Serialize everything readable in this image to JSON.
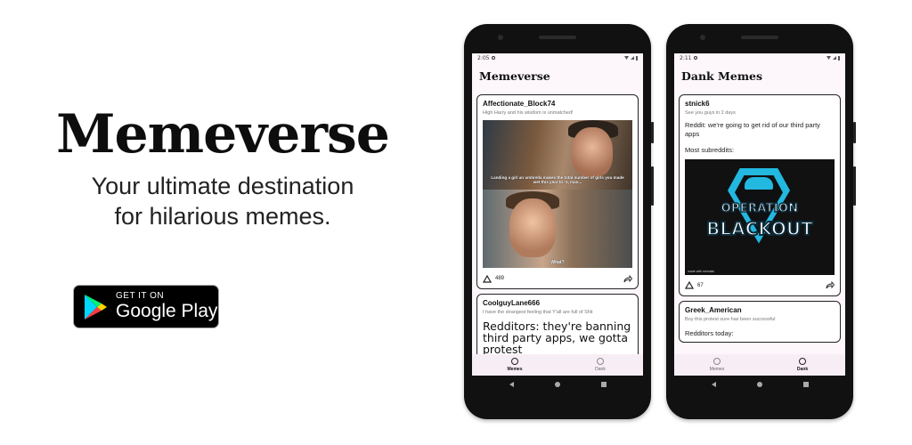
{
  "hero": {
    "title": "Memeverse",
    "subtitle_line1": "Your ultimate destination",
    "subtitle_line2": "for hilarious memes."
  },
  "store_badge": {
    "small": "GET IT ON",
    "big": "Google Play"
  },
  "phone1": {
    "time": "2:05",
    "app_title": "Memeverse",
    "post1": {
      "user": "Affectionate_Block74",
      "title": "High Harry and his wisdom is unmatched!",
      "caption_top": "Landing a girl an umbrella makes the total number of girls you made wet this year to -1, man...",
      "caption_bottom": "What?",
      "votes": "489"
    },
    "post2": {
      "user": "CoolguyLane666",
      "title": "I have the strangest feeling that Y'all are full of Shit",
      "text": "Redditors: they're banning third party apps, we gotta protest"
    },
    "nav": {
      "item1": "Memes",
      "item2": "Dank"
    }
  },
  "phone2": {
    "time": "2:11",
    "app_title": "Dank Memes",
    "post1": {
      "user": "stnick6",
      "title": "See you guys in 2 days",
      "text1": "Reddit: we're going to get rid of our third party apps",
      "text2": "Most subreddits:",
      "image_line1": "OPERATION",
      "image_line2": "BLACKOUT",
      "image_credit": "made with mematic",
      "votes": "67"
    },
    "post2": {
      "user": "Greek_American",
      "title": "Boy this protest sure has been successful",
      "text": "Redditors today:"
    },
    "nav": {
      "item1": "Memes",
      "item2": "Dank"
    }
  }
}
